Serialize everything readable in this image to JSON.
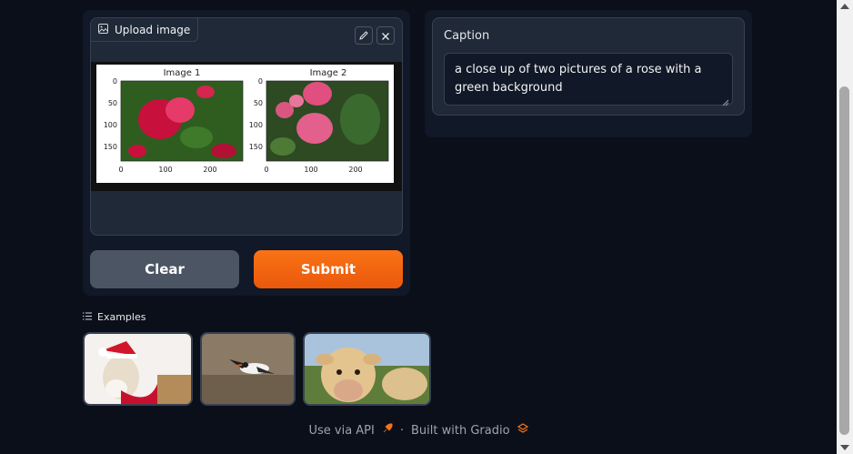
{
  "image_input": {
    "label": "Upload image",
    "plot": {
      "left_title": "Image 1",
      "right_title": "Image 2",
      "y_ticks": [
        "0",
        "50",
        "100",
        "150"
      ],
      "x_ticks": [
        "0",
        "100",
        "200"
      ]
    }
  },
  "buttons": {
    "clear_label": "Clear",
    "submit_label": "Submit"
  },
  "caption": {
    "label": "Caption",
    "value": "a close up of two pictures of a rose with a green background"
  },
  "examples": {
    "label": "Examples",
    "items": [
      "greyhound",
      "bird",
      "cow"
    ]
  },
  "footer": {
    "api_label": "Use via API",
    "separator": "·",
    "built_label": "Built with Gradio"
  },
  "colors": {
    "accent": "#f97316",
    "background": "#0b0f19",
    "panel": "#111827",
    "block": "#1f2937"
  }
}
